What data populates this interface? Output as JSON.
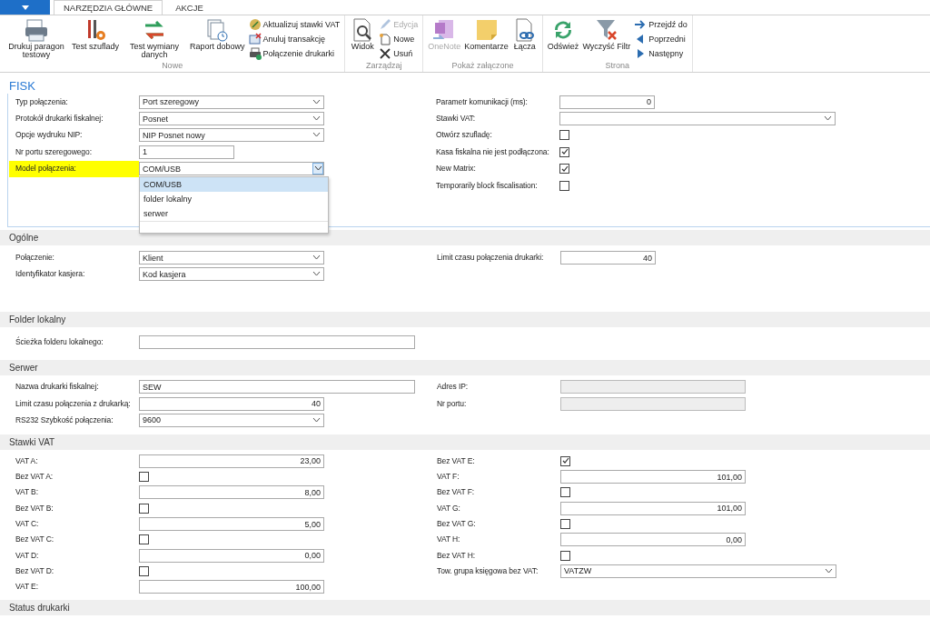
{
  "ribbon": {
    "tabs": [
      {
        "label": "NARZĘDZIA GŁÓWNE",
        "selected": true
      },
      {
        "label": "AKCJE",
        "selected": false
      }
    ],
    "groups": [
      {
        "label": "Nowe",
        "items": [
          {
            "kind": "large",
            "label": "Drukuj paragon testowy",
            "disabled": false
          },
          {
            "kind": "large",
            "label": "Test szuflady",
            "disabled": false
          },
          {
            "kind": "large",
            "label": "Test wymiany danych",
            "disabled": false
          },
          {
            "kind": "large",
            "label": "Raport dobowy",
            "disabled": false
          },
          {
            "kind": "small",
            "label": "Aktualizuj stawki VAT",
            "disabled": false
          },
          {
            "kind": "small",
            "label": "Anuluj transakcję",
            "disabled": false
          },
          {
            "kind": "small",
            "label": "Połączenie drukarki",
            "disabled": false
          }
        ]
      },
      {
        "label": "Zarządzaj",
        "items": [
          {
            "kind": "large",
            "label": "Widok",
            "disabled": false
          },
          {
            "kind": "small",
            "label": "Edycja",
            "disabled": true
          },
          {
            "kind": "small",
            "label": "Nowe",
            "disabled": false
          },
          {
            "kind": "small",
            "label": "Usuń",
            "disabled": false
          }
        ]
      },
      {
        "label": "Pokaż załączone",
        "items": [
          {
            "kind": "large",
            "label": "OneNote",
            "disabled": true
          },
          {
            "kind": "large",
            "label": "Komentarze",
            "disabled": false
          },
          {
            "kind": "large",
            "label": "Łącza",
            "disabled": false
          }
        ]
      },
      {
        "label": "Strona",
        "items": [
          {
            "kind": "large",
            "label": "Odśwież",
            "disabled": false
          },
          {
            "kind": "large",
            "label": "Wyczyść Filtr",
            "disabled": false
          },
          {
            "kind": "small",
            "label": "Przejdź do",
            "disabled": false
          },
          {
            "kind": "small",
            "label": "Poprzedni",
            "disabled": false
          },
          {
            "kind": "small",
            "label": "Następny",
            "disabled": false
          }
        ]
      }
    ]
  },
  "page_title": "FISK",
  "sections": [
    {
      "left": [
        {
          "label": "Typ połączenia:",
          "kind": "select",
          "value": "Port szeregowy"
        },
        {
          "label": "Protokół drukarki fiskalnej:",
          "kind": "select",
          "value": "Posnet"
        },
        {
          "label": "Opcje wydruku NIP:",
          "kind": "select",
          "value": "NIP Posnet nowy"
        },
        {
          "label": "Nr portu szeregowego:",
          "kind": "short",
          "value": "1"
        },
        {
          "label": "Model połączenia:",
          "kind": "select",
          "value": "COM/USB",
          "highlighted": true,
          "options": [
            {
              "label": "COM/USB",
              "selected": true
            },
            {
              "label": "folder lokalny",
              "selected": false
            },
            {
              "label": "serwer",
              "selected": false
            }
          ]
        }
      ],
      "right": [
        {
          "label": "Parametr komunikacji (ms):",
          "kind": "number",
          "value": "0"
        },
        {
          "label": "Stawki VAT:",
          "kind": "select"
        },
        {
          "label": "Otwórz szufladę:",
          "kind": "check",
          "checked": false
        },
        {
          "label": "Kasa fiskalna nie jest podłączona:",
          "kind": "check",
          "checked": true
        },
        {
          "label": "New Matrix:",
          "kind": "check",
          "checked": true
        },
        {
          "label": "Temporarily block fiscalisation:",
          "kind": "check",
          "checked": false
        }
      ]
    },
    {
      "title": "Ogólne",
      "left": [
        {
          "label": "Połączenie:",
          "kind": "select",
          "value": "Klient"
        },
        {
          "label": "Identyfikator kasjera:",
          "kind": "select",
          "value": "Kod kasjera"
        }
      ],
      "right": [
        {
          "label": "Limit czasu połączenia drukarki:",
          "kind": "number",
          "value": "40"
        }
      ]
    },
    {
      "title": "Folder lokalny",
      "left": [
        {
          "label": "Ścieżka folderu lokalnego:",
          "kind": "text"
        }
      ]
    },
    {
      "title": "Serwer",
      "left": [
        {
          "label": "Nazwa drukarki fiskalnej:",
          "kind": "text",
          "value": "SEW"
        },
        {
          "label": "Limit czasu połączenia z drukarką:",
          "kind": "number",
          "value": "40"
        },
        {
          "label": "RS232 Szybkość połączenia:",
          "kind": "select",
          "value": "9600"
        }
      ],
      "right": [
        {
          "label": "Adres IP:",
          "kind": "readonly"
        },
        {
          "label": "Nr portu:",
          "kind": "readonly"
        }
      ]
    },
    {
      "title": "Stawki VAT",
      "left": [
        {
          "label": "VAT A:",
          "kind": "number",
          "value": "23,00"
        },
        {
          "label": "Bez VAT A:",
          "kind": "check",
          "checked": false
        },
        {
          "label": "VAT B:",
          "kind": "number",
          "value": "8,00"
        },
        {
          "label": "Bez VAT B:",
          "kind": "check",
          "checked": false
        },
        {
          "label": "VAT C:",
          "kind": "number",
          "value": "5,00"
        },
        {
          "label": "Bez VAT C:",
          "kind": "check",
          "checked": false
        },
        {
          "label": "VAT D:",
          "kind": "number",
          "value": "0,00"
        },
        {
          "label": "Bez VAT D:",
          "kind": "check",
          "checked": false
        },
        {
          "label": "VAT E:",
          "kind": "number",
          "value": "100,00"
        }
      ],
      "right": [
        {
          "label": "Bez VAT E:",
          "kind": "check",
          "checked": true
        },
        {
          "label": "VAT F:",
          "kind": "number",
          "value": "101,00"
        },
        {
          "label": "Bez VAT F:",
          "kind": "check",
          "checked": false
        },
        {
          "label": "VAT G:",
          "kind": "number",
          "value": "101,00"
        },
        {
          "label": "Bez VAT G:",
          "kind": "check",
          "checked": false
        },
        {
          "label": "VAT H:",
          "kind": "number",
          "value": "0,00"
        },
        {
          "label": "Bez VAT H:",
          "kind": "check",
          "checked": false
        },
        {
          "label": "Tow. grupa księgowa bez VAT:",
          "kind": "select",
          "value": "VATZW"
        }
      ]
    },
    {
      "title": "Status drukarki"
    }
  ]
}
